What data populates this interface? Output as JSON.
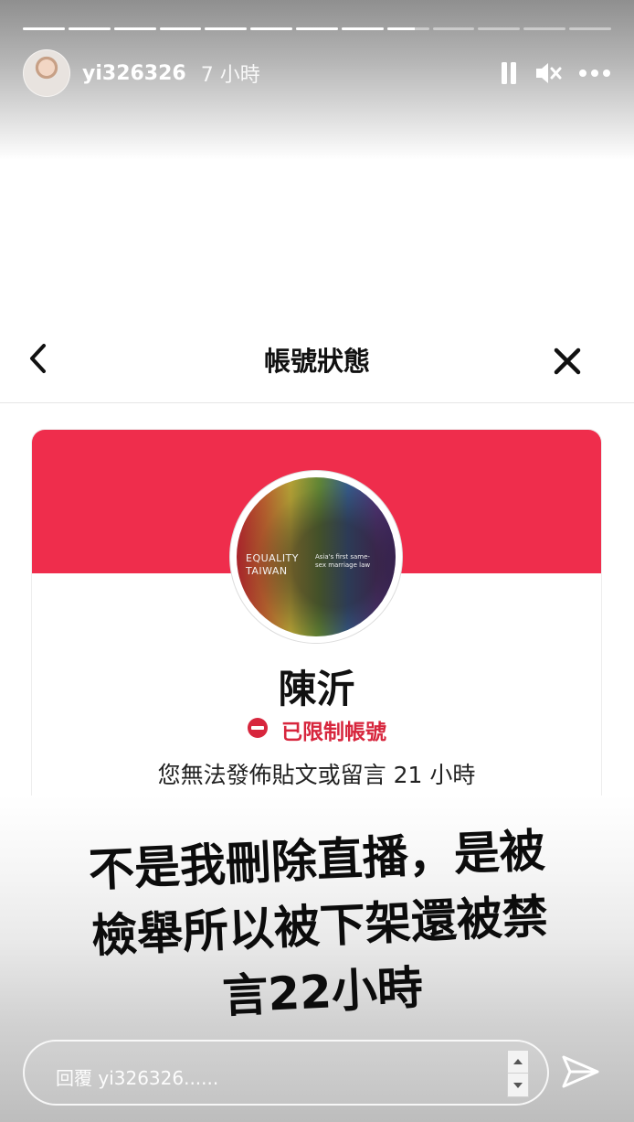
{
  "story": {
    "segments_total": 13,
    "segments_done": 8,
    "current_segment_progress": 0.65
  },
  "header": {
    "username": "yi326326",
    "time": "7 小時",
    "icons": [
      "pause-icon",
      "muted-speaker-icon",
      "more-options-icon"
    ]
  },
  "screenshot": {
    "nav_title": "帳號狀態",
    "back_icon": "chevron-left-icon",
    "close_icon": "close-icon",
    "card": {
      "band_color": "#ef2d4c",
      "profile_text_1": "EQUALITY",
      "profile_text_2": "TAIWAN",
      "profile_text_3": "Asia's first same-sex marriage law",
      "name": "陳沂",
      "status_label": "已限制帳號",
      "status_color": "#d7263d",
      "restriction_text": "您無法發佈貼文或留言 21 小時"
    }
  },
  "caption": {
    "line1": "不是我刪除直播，是被",
    "line2": "檢舉所以被下架還被禁",
    "line3": "言22小時"
  },
  "reply": {
    "placeholder": "回覆 yi326326......",
    "send_icon": "send-icon"
  }
}
